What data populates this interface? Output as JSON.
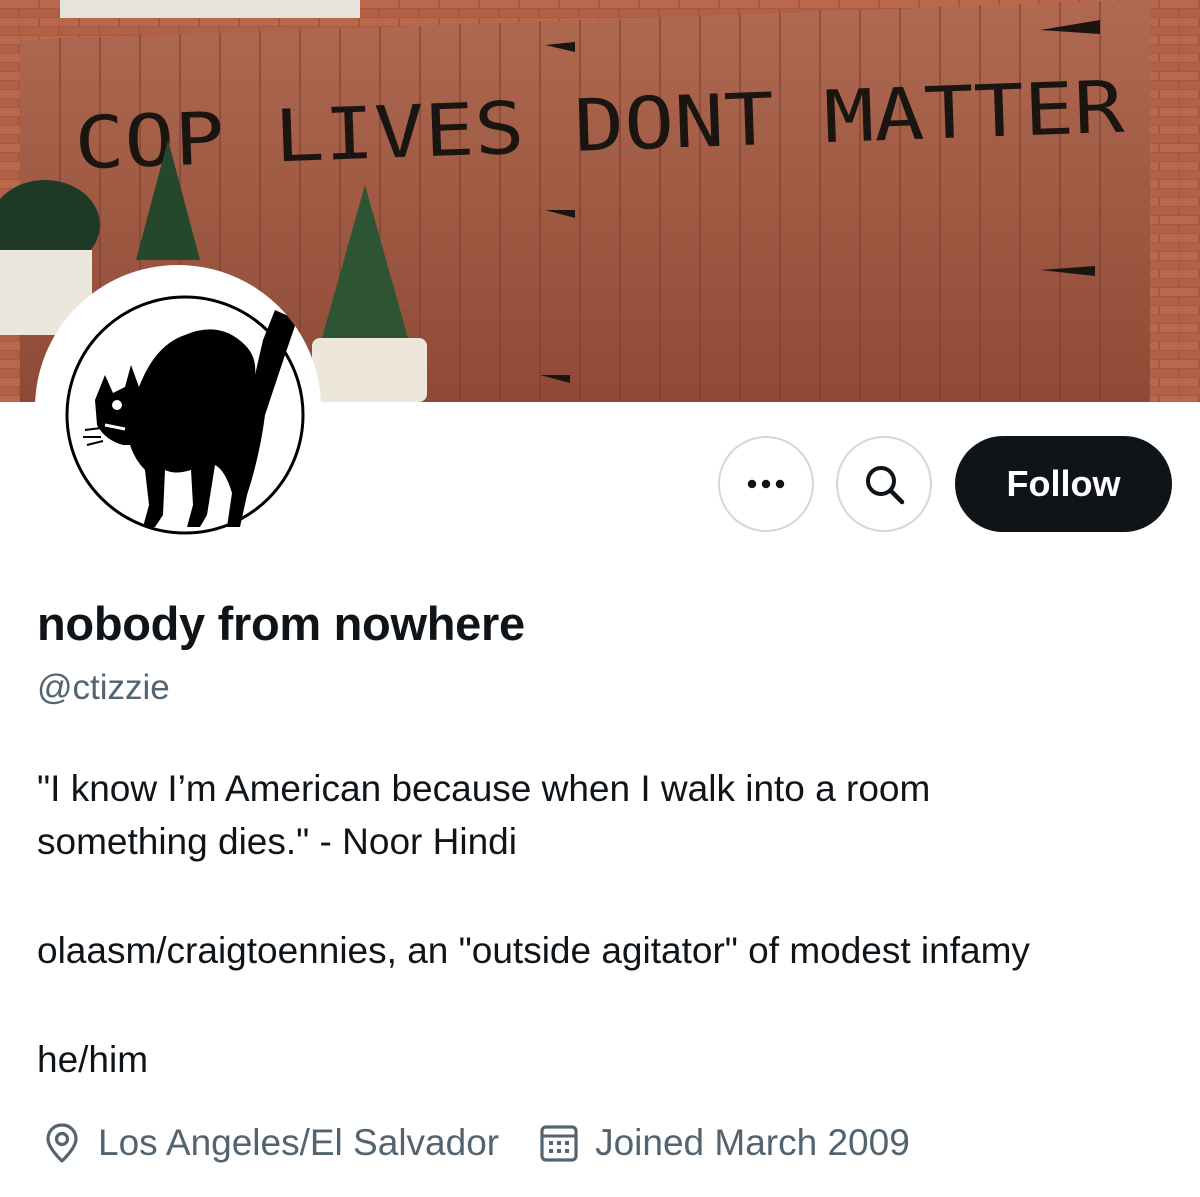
{
  "banner": {
    "graffiti_text": "COP LIVES DONT MATTER"
  },
  "avatar": {
    "description_icon": "black-cat-icon"
  },
  "actions": {
    "more_icon": "ellipsis-icon",
    "more_label": "•••",
    "search_icon": "search-icon",
    "follow_label": "Follow"
  },
  "profile": {
    "display_name": "nobody from nowhere",
    "handle": "@ctizzie",
    "bio_lines": [
      "\"I know I’m American because when I walk into a room",
      "something dies.\" - Noor Hindi",
      "olaasm/craigtoennies, an \"outside agitator\" of modest infamy",
      "he/him"
    ],
    "location": "Los Angeles/El Salvador",
    "location_icon": "location-pin-icon",
    "joined": "Joined March 2009",
    "joined_icon": "calendar-icon"
  },
  "colors": {
    "text_primary": "#0f1419",
    "text_secondary": "#536471",
    "button_border": "#cfd9de",
    "follow_bg": "#0f1419",
    "fence": "#a05a44"
  }
}
